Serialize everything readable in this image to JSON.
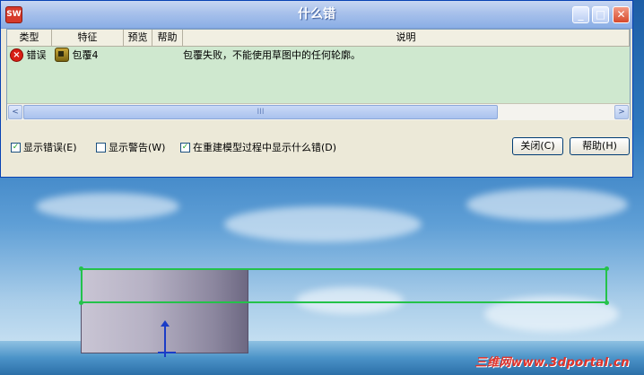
{
  "window": {
    "title": "什么错",
    "app_icon_text": "SW"
  },
  "list": {
    "columns": [
      "类型",
      "特征",
      "预览",
      "帮助",
      "说明"
    ],
    "rows": [
      {
        "type": "错误",
        "feature": "包覆4",
        "preview": "",
        "help": "",
        "description": "包覆失败，不能使用草图中的任何轮廓。"
      }
    ]
  },
  "controls": {
    "show_errors": {
      "label": "显示错误(E)",
      "checked": true
    },
    "show_warnings": {
      "label": "显示警告(W)",
      "checked": false
    },
    "show_during_rebuild": {
      "label": "在重建模型过程中显示什么错(D)",
      "checked": true
    },
    "close_label": "关闭(C)",
    "help_label": "帮助(H)"
  },
  "scrollbar": {
    "left_arrow": "<",
    "right_arrow": ">",
    "thumb_grip": "III"
  },
  "watermark": "三维网www.3dportal.cn",
  "colors": {
    "sketch": "#24c24a",
    "error": "#d81e14",
    "list_background": "#cfe8cf"
  }
}
